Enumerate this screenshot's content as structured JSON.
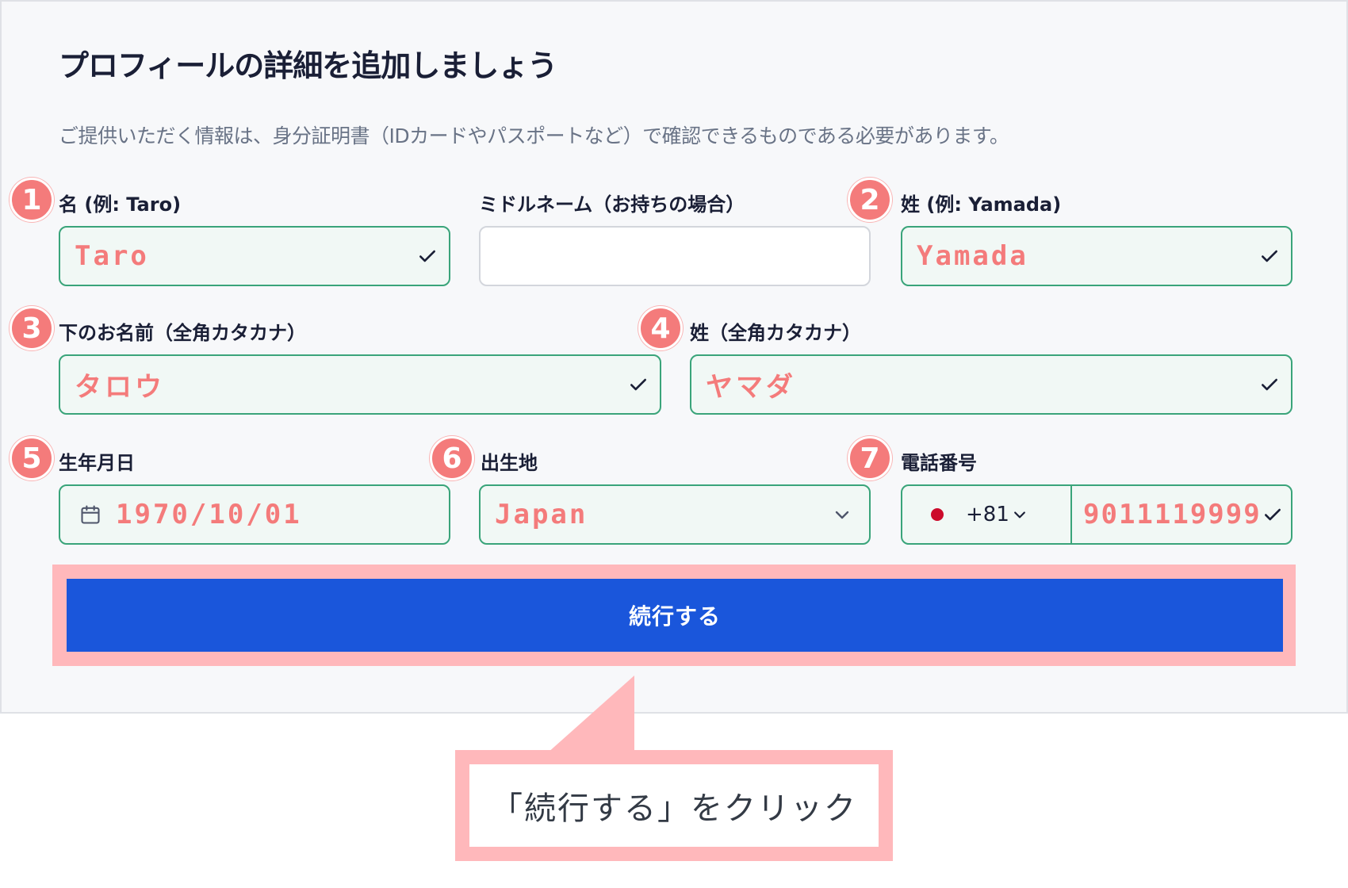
{
  "page": {
    "title": "プロフィールの詳細を追加しましょう",
    "subtitle": "ご提供いただく情報は、身分証明書（IDカードやパスポートなど）で確認できるものである必要があります。"
  },
  "fields": {
    "first_name": {
      "badge": "1",
      "label": "名 (例: Taro)",
      "value": "Taro",
      "status_icon": "check-icon"
    },
    "middle_name": {
      "label": "ミドルネーム（お持ちの場合）",
      "value": ""
    },
    "last_name": {
      "badge": "2",
      "label": "姓 (例: Yamada)",
      "value": "Yamada",
      "status_icon": "check-icon"
    },
    "first_name_kana": {
      "badge": "3",
      "label": "下のお名前（全角カタカナ）",
      "value": "タロウ",
      "status_icon": "check-icon"
    },
    "last_name_kana": {
      "badge": "4",
      "label": "姓（全角カタカナ）",
      "value": "ヤマダ",
      "status_icon": "check-icon"
    },
    "birth_date": {
      "badge": "5",
      "label": "生年月日",
      "value": "1970/10/01",
      "icon": "calendar-icon"
    },
    "birth_place": {
      "badge": "6",
      "label": "出生地",
      "value": "Japan",
      "icon": "chevron-down-icon"
    },
    "phone": {
      "badge": "7",
      "label": "電話番号",
      "country_code": "+81",
      "flag": "japan-flag",
      "value": "9011119999",
      "status_icon": "check-icon"
    }
  },
  "actions": {
    "continue_label": "続行する"
  },
  "callout": {
    "text": "「続行する」をクリック"
  },
  "colors": {
    "accent": "#1a56db",
    "valid_border": "#3aa47a",
    "valid_bg": "#f1f8f5",
    "annotation": "#f47b7b",
    "annotation_frame": "#ffb8bb"
  }
}
